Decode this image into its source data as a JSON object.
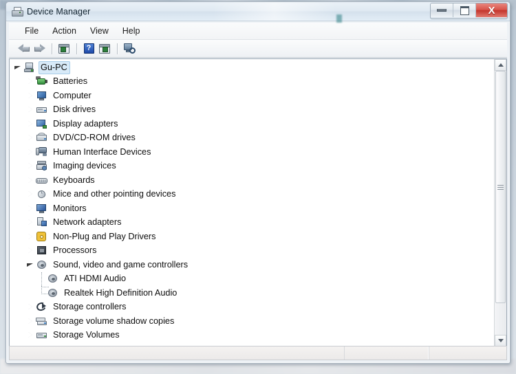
{
  "window": {
    "title": "Device Manager",
    "icon": "device-manager-icon",
    "controls": {
      "minimize": "–",
      "maximize": "□",
      "close": "X"
    }
  },
  "menubar": {
    "items": [
      {
        "label": "File"
      },
      {
        "label": "Action"
      },
      {
        "label": "View"
      },
      {
        "label": "Help"
      }
    ]
  },
  "toolbar": {
    "buttons": [
      {
        "name": "back-button",
        "icon": "arrow-left-icon"
      },
      {
        "name": "forward-button",
        "icon": "arrow-right-icon"
      },
      {
        "name": "properties-button",
        "icon": "properties-panel-icon"
      },
      {
        "name": "help-button",
        "icon": "help-question-icon"
      },
      {
        "name": "show-hidden-button",
        "icon": "panel-green-icon"
      },
      {
        "name": "scan-hardware-changes-button",
        "icon": "scan-monitor-icon"
      }
    ]
  },
  "tree": {
    "root": {
      "label": "Gu-PC",
      "icon": "computer-root-icon",
      "selected": true,
      "expanded": true
    },
    "nodes": [
      {
        "label": "Batteries",
        "icon": "battery-icon",
        "expanded": false,
        "level": 1
      },
      {
        "label": "Computer",
        "icon": "computer-icon",
        "expanded": false,
        "level": 1
      },
      {
        "label": "Disk drives",
        "icon": "disk-drive-icon",
        "expanded": false,
        "level": 1
      },
      {
        "label": "Display adapters",
        "icon": "display-adapter-icon",
        "expanded": false,
        "level": 1
      },
      {
        "label": "DVD/CD-ROM drives",
        "icon": "dvd-drive-icon",
        "expanded": false,
        "level": 1
      },
      {
        "label": "Human Interface Devices",
        "icon": "hid-icon",
        "expanded": false,
        "level": 1
      },
      {
        "label": "Imaging devices",
        "icon": "imaging-device-icon",
        "expanded": false,
        "level": 1
      },
      {
        "label": "Keyboards",
        "icon": "keyboard-icon",
        "expanded": false,
        "level": 1
      },
      {
        "label": "Mice and other pointing devices",
        "icon": "mouse-icon",
        "expanded": false,
        "level": 1
      },
      {
        "label": "Monitors",
        "icon": "monitor-icon",
        "expanded": false,
        "level": 1
      },
      {
        "label": "Network adapters",
        "icon": "network-adapter-icon",
        "expanded": false,
        "level": 1
      },
      {
        "label": "Non-Plug and Play Drivers",
        "icon": "gear-icon",
        "expanded": false,
        "level": 1
      },
      {
        "label": "Processors",
        "icon": "processor-icon",
        "expanded": false,
        "level": 1
      },
      {
        "label": "Sound, video and game controllers",
        "icon": "sound-controller-icon",
        "expanded": true,
        "level": 1
      },
      {
        "label": "ATI HDMI Audio",
        "icon": "sound-device-icon",
        "expanded": null,
        "level": 2
      },
      {
        "label": "Realtek High Definition Audio",
        "icon": "sound-device-icon",
        "expanded": null,
        "level": 2
      },
      {
        "label": "Storage controllers",
        "icon": "storage-controller-icon",
        "expanded": false,
        "level": 1
      },
      {
        "label": "Storage volume shadow copies",
        "icon": "shadow-copy-icon",
        "expanded": false,
        "level": 1
      },
      {
        "label": "Storage Volumes",
        "icon": "storage-volume-icon",
        "expanded": false,
        "level": 1
      }
    ]
  },
  "scrollbar": {
    "up_arrow": "scroll-up-icon",
    "down_arrow": "scroll-down-icon",
    "thumb": "scroll-thumb"
  },
  "statusbar": {
    "main_text": "",
    "pane2_text": "",
    "pane3_text": ""
  }
}
